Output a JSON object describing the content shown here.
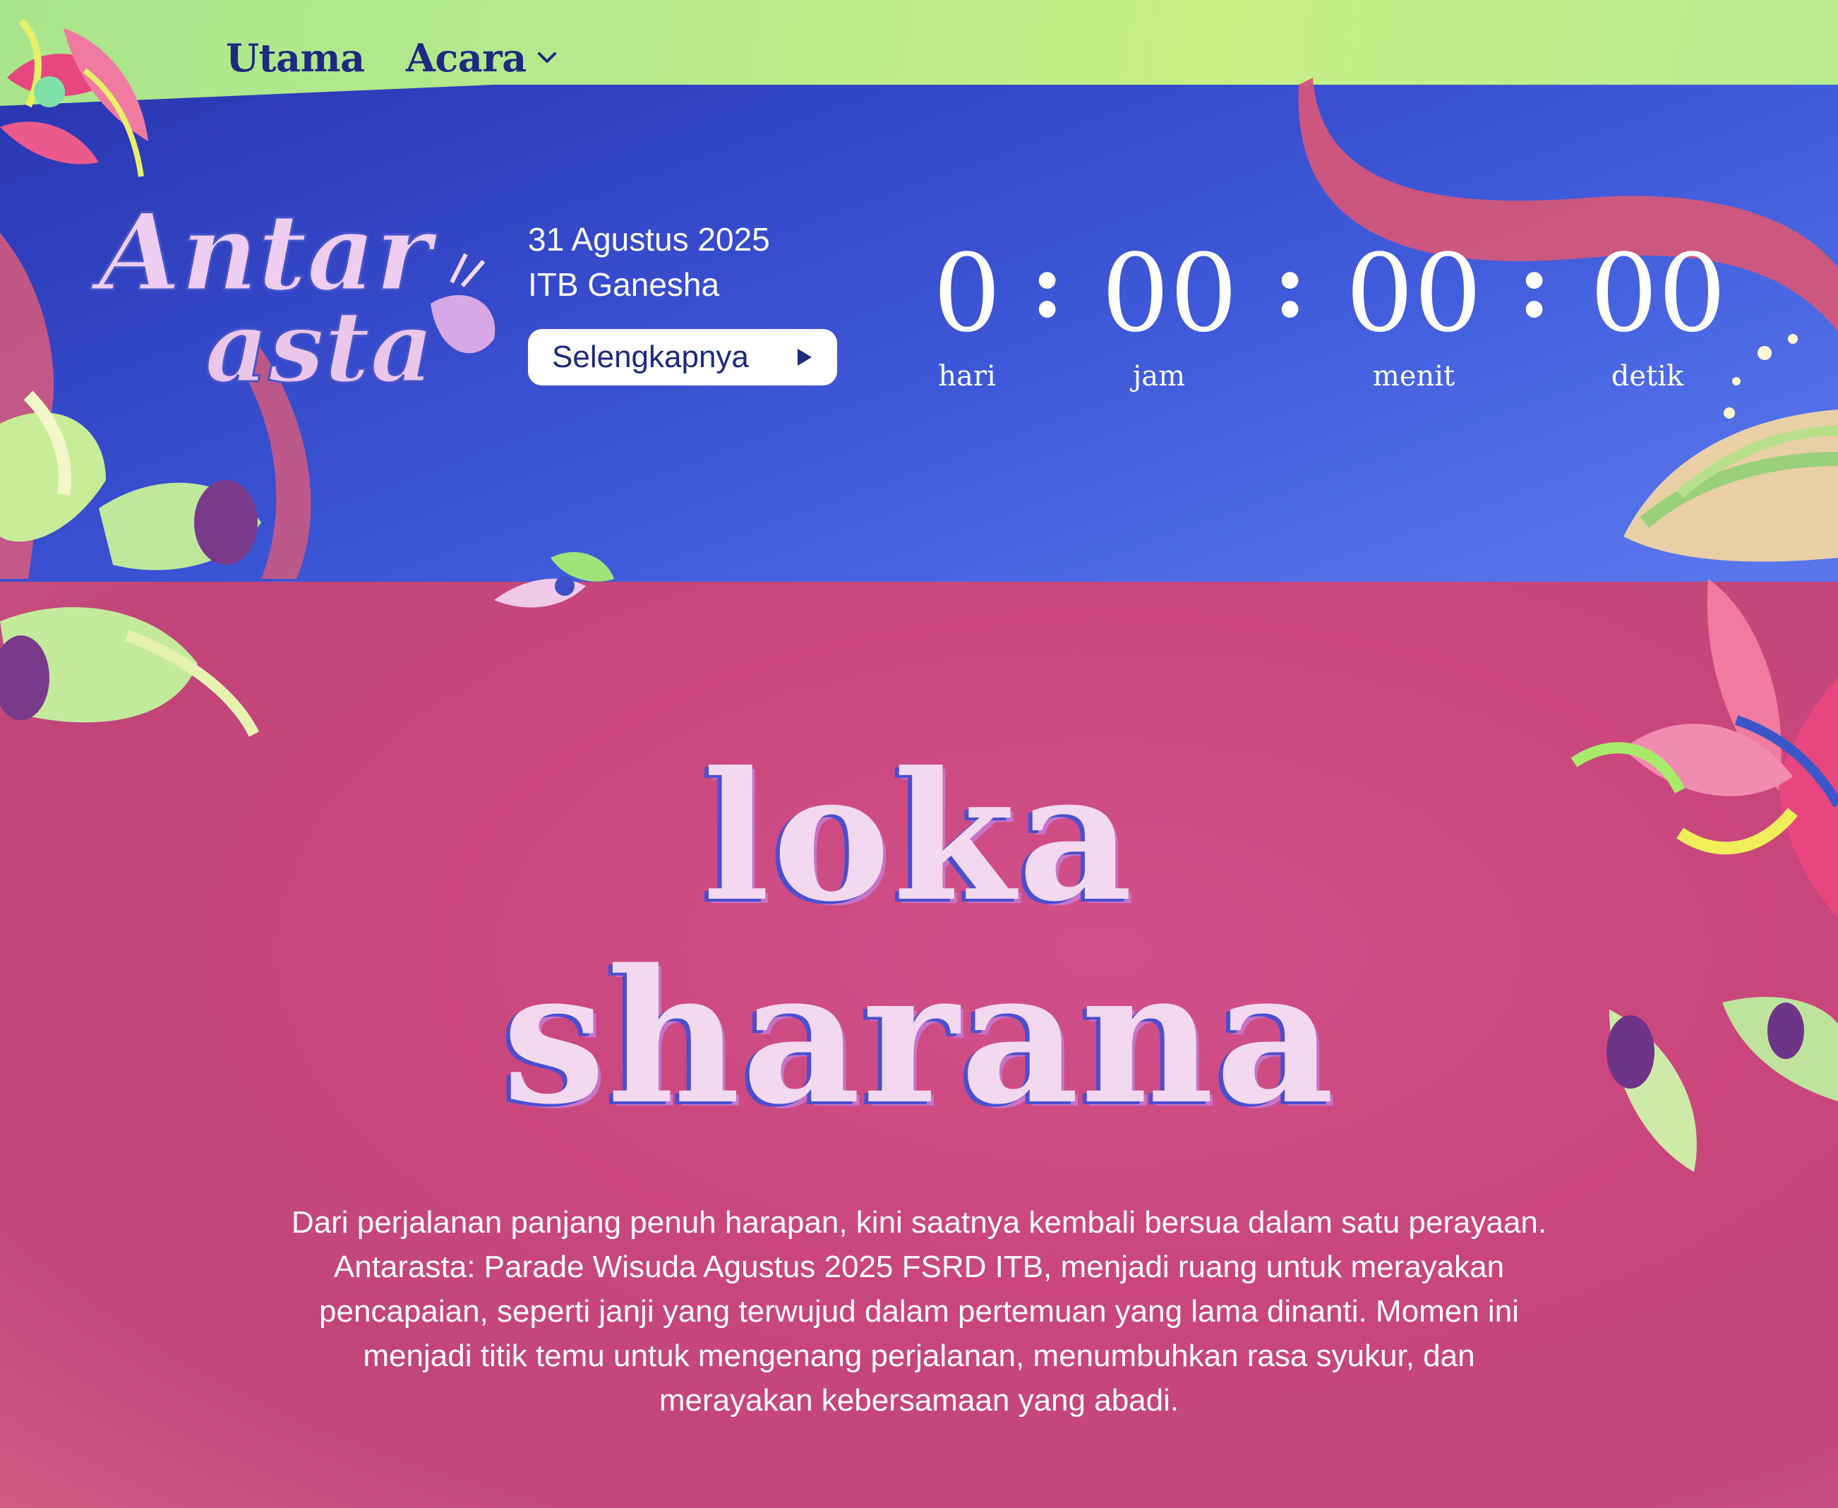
{
  "nav": {
    "home_label": "Utama",
    "event_label": "Acara",
    "event_icon": "chevron-down-icon"
  },
  "header": {
    "logo_text": "Antarasta",
    "date": "31 Agustus 2025",
    "venue": "ITB Ganesha",
    "more_button_label": "Selengkapnya",
    "more_button_icon": "play-triangle-icon"
  },
  "countdown": {
    "days": "0",
    "hours": "00",
    "minutes": "00",
    "seconds": "00",
    "separator": ":",
    "labels": {
      "days": "hari",
      "hours": "jam",
      "minutes": "menit",
      "seconds": "detik"
    }
  },
  "main": {
    "title_line1": "loka",
    "title_line2": "sharana",
    "description": "Dari perjalanan panjang penuh harapan, kini saatnya kembali bersua dalam satu perayaan. Antarasta: Parade Wisuda Agustus 2025 FSRD ITB, menjadi ruang untuk merayakan pencapaian, seperti janji yang terwujud dalam pertemuan yang lama dinanti. Momen ini menjadi titik temu untuk mengenang perjalanan, menumbuhkan rasa syukur, dan merayakan kebersamaan yang abadi."
  },
  "colors": {
    "green": "#b7ea8c",
    "blue": "#3448c8",
    "pink": "#c9467c",
    "navy_text": "#1d2a80",
    "title_fill": "#f3d9f0"
  }
}
